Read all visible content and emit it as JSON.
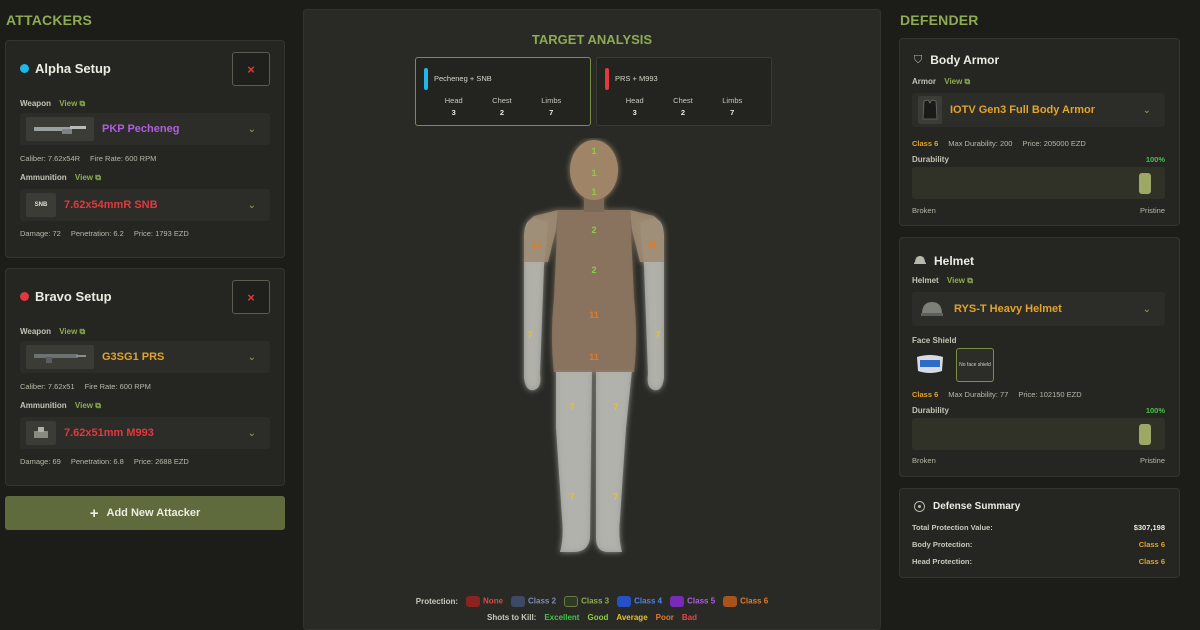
{
  "attackers": {
    "title": "ATTACKERS",
    "setups": [
      {
        "name": "Alpha Setup",
        "dot_color": "#1fb6e8",
        "remove": "×",
        "weapon_label": "Weapon",
        "view": "View ⧉",
        "weapon": "PKP Pecheneg",
        "weapon_color": "#b05ee0",
        "weapon_stats": [
          "Caliber: 7.62x54R",
          "Fire Rate: 600 RPM"
        ],
        "ammo_label": "Ammunition",
        "ammo_thumb": "SNB",
        "ammo": "7.62x54mmR SNB",
        "ammo_stats": [
          "Damage: 72",
          "Penetration: 6.2",
          "Price: 1793 EZD"
        ]
      },
      {
        "name": "Bravo Setup",
        "dot_color": "#e0393e",
        "remove": "×",
        "weapon_label": "Weapon",
        "view": "View ⧉",
        "weapon": "G3SG1 PRS",
        "weapon_color": "#e3a32a",
        "weapon_stats": [
          "Caliber: 7.62x51",
          "Fire Rate: 600 RPM"
        ],
        "ammo_label": "Ammunition",
        "ammo_thumb": "",
        "ammo": "7.62x51mm M993",
        "ammo_stats": [
          "Damage: 69",
          "Penetration: 6.8",
          "Price: 2688 EZD"
        ]
      }
    ],
    "add_button": "Add New Attacker"
  },
  "target": {
    "title": "TARGET ANALYSIS",
    "cards": [
      {
        "name": "Pecheneg + SNB",
        "color": "#1fb6e8",
        "head_label": "Head",
        "chest_label": "Chest",
        "limbs_label": "Limbs",
        "head": "3",
        "chest": "2",
        "limbs": "7"
      },
      {
        "name": "PRS + M993",
        "color": "#e0393e",
        "head_label": "Head",
        "chest_label": "Chest",
        "limbs_label": "Limbs",
        "head": "3",
        "chest": "2",
        "limbs": "7"
      }
    ],
    "zones": {
      "head_top": "1",
      "head_mid": "1",
      "head_low": "1",
      "chest_top": "2",
      "chest_low": "2",
      "stomach_top": "11",
      "stomach_low": "11",
      "l_shoulder": "11",
      "r_shoulder": "11",
      "l_arm": "7",
      "r_arm": "7",
      "l_thigh": "7",
      "r_thigh": "7",
      "l_calf": "7",
      "r_calf": "7"
    },
    "legend": {
      "protection_label": "Protection:",
      "classes": [
        {
          "label": "None",
          "color": "#8a2222"
        },
        {
          "label": "Class 2",
          "color": "#3c4a66"
        },
        {
          "label": "Class 3",
          "color": "#2e3a24"
        },
        {
          "label": "Class 4",
          "color": "#2450c8"
        },
        {
          "label": "Class 5",
          "color": "#7a2ab8"
        },
        {
          "label": "Class 6",
          "color": "#a8521c"
        }
      ],
      "class_text_colors": [
        "#e04848",
        "#7d8ab8",
        "#8dab52",
        "#4b82f0",
        "#b05ee0",
        "#e07a2a"
      ],
      "stk_label": "Shots to Kill:",
      "stk": [
        {
          "label": "Excellent",
          "color": "#45c24a"
        },
        {
          "label": "Good",
          "color": "#8dce3e"
        },
        {
          "label": "Average",
          "color": "#e3c22a"
        },
        {
          "label": "Poor",
          "color": "#e07a2a"
        },
        {
          "label": "Bad",
          "color": "#e04848"
        }
      ]
    }
  },
  "defender": {
    "title": "DEFENDER",
    "armor": {
      "title": "Body Armor",
      "label": "Armor",
      "view": "View ⧉",
      "name": "IOTV Gen3 Full Body Armor",
      "class": "Class 6",
      "max_dur": "Max Durability: 200",
      "price": "Price: 205000 EZD",
      "dur_label": "Durability",
      "dur_pct": "100%",
      "dur_fraction": 1.0,
      "broken": "Broken",
      "pristine": "Pristine"
    },
    "helmet": {
      "title": "Helmet",
      "label": "Helmet",
      "view": "View ⧉",
      "name": "RYS-T Heavy Helmet",
      "face_shield_label": "Face Shield",
      "face_shield_none": "No face shield",
      "class": "Class 6",
      "max_dur": "Max Durability: 77",
      "price": "Price: 102150 EZD",
      "dur_label": "Durability",
      "dur_pct": "100%",
      "dur_fraction": 1.0,
      "broken": "Broken",
      "pristine": "Pristine"
    },
    "summary": {
      "title": "Defense Summary",
      "rows": [
        {
          "label": "Total Protection Value:",
          "value": "$307,198",
          "color": "#e8e8dc"
        },
        {
          "label": "Body Protection:",
          "value": "Class 6",
          "color": "#e3a32a"
        },
        {
          "label": "Head Protection:",
          "value": "Class 6",
          "color": "#e3a32a"
        }
      ]
    }
  }
}
